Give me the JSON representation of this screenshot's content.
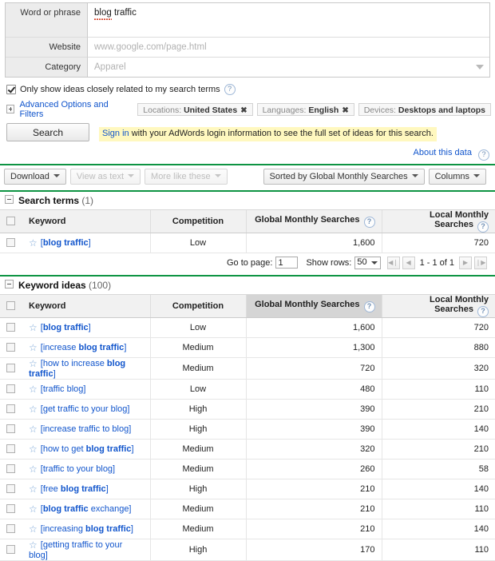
{
  "form": {
    "word_label": "Word or phrase",
    "word_value": "blog traffic",
    "word_misspelled": "blog",
    "word_rest": " traffic",
    "website_label": "Website",
    "website_placeholder": "www.google.com/page.html",
    "category_label": "Category",
    "category_placeholder": "Apparel"
  },
  "options": {
    "only_show_label": "Only show ideas closely related to my search terms",
    "advanced_label": "Advanced Options and Filters",
    "chips": [
      {
        "prefix": "Locations: ",
        "value": "United States",
        "closable": true,
        "x": "✖"
      },
      {
        "prefix": "Languages: ",
        "value": "English",
        "closable": true,
        "x": "✖"
      },
      {
        "prefix": "Devices: ",
        "value": "Desktops and laptops",
        "closable": false,
        "x": ""
      }
    ]
  },
  "search": {
    "button_label": "Search",
    "notice_link": "Sign in",
    "notice_text": " with your AdWords login information to see the full set of ideas for this search.",
    "about_link": "About this data"
  },
  "toolbar": {
    "download_label": "Download",
    "view_as_text_label": "View as text",
    "more_like_these_label": "More like these",
    "sorted_by_label": "Sorted by Global Monthly Searches",
    "columns_label": "Columns"
  },
  "search_terms_section": {
    "title": "Search terms",
    "count": "(1)",
    "headers": {
      "keyword": "Keyword",
      "competition": "Competition",
      "global": "Global Monthly Searches",
      "local": "Local Monthly Searches"
    },
    "rows": [
      {
        "keyword_pre": "[",
        "keyword_bold": "blog traffic",
        "keyword_post": "]",
        "competition": "Low",
        "global": "1,600",
        "local": "720"
      }
    ]
  },
  "pager": {
    "goto_label": "Go to page:",
    "goto_value": "1",
    "showrows_label": "Show rows:",
    "showrows_value": "50",
    "range": "1 - 1 of 1",
    "first": "◀❘",
    "prev": "◀",
    "next": "▶",
    "last": "❘▶"
  },
  "keyword_ideas_section": {
    "title": "Keyword ideas",
    "count": "(100)",
    "headers": {
      "keyword": "Keyword",
      "competition": "Competition",
      "global": "Global Monthly Searches",
      "local": "Local Monthly Searches"
    },
    "rows": [
      {
        "parts": [
          {
            "t": "[",
            "b": false
          },
          {
            "t": "blog traffic",
            "b": true
          },
          {
            "t": "]",
            "b": false
          }
        ],
        "competition": "Low",
        "global": "1,600",
        "local": "720"
      },
      {
        "parts": [
          {
            "t": "[increase ",
            "b": false
          },
          {
            "t": "blog traffic",
            "b": true
          },
          {
            "t": "]",
            "b": false
          }
        ],
        "competition": "Medium",
        "global": "1,300",
        "local": "880"
      },
      {
        "parts": [
          {
            "t": "[how to increase ",
            "b": false
          },
          {
            "t": "blog traffic",
            "b": true
          },
          {
            "t": "]",
            "b": false
          }
        ],
        "competition": "Medium",
        "global": "720",
        "local": "320"
      },
      {
        "parts": [
          {
            "t": "[traffic blog]",
            "b": false
          }
        ],
        "competition": "Low",
        "global": "480",
        "local": "110"
      },
      {
        "parts": [
          {
            "t": "[get traffic to your blog]",
            "b": false
          }
        ],
        "competition": "High",
        "global": "390",
        "local": "210"
      },
      {
        "parts": [
          {
            "t": "[increase traffic to blog]",
            "b": false
          }
        ],
        "competition": "High",
        "global": "390",
        "local": "140"
      },
      {
        "parts": [
          {
            "t": "[how to get ",
            "b": false
          },
          {
            "t": "blog traffic",
            "b": true
          },
          {
            "t": "]",
            "b": false
          }
        ],
        "competition": "Medium",
        "global": "320",
        "local": "210"
      },
      {
        "parts": [
          {
            "t": "[traffic to your blog]",
            "b": false
          }
        ],
        "competition": "Medium",
        "global": "260",
        "local": "58"
      },
      {
        "parts": [
          {
            "t": "[free ",
            "b": false
          },
          {
            "t": "blog traffic",
            "b": true
          },
          {
            "t": "]",
            "b": false
          }
        ],
        "competition": "High",
        "global": "210",
        "local": "140"
      },
      {
        "parts": [
          {
            "t": "[",
            "b": false
          },
          {
            "t": "blog traffic",
            "b": true
          },
          {
            "t": " exchange]",
            "b": false
          }
        ],
        "competition": "Medium",
        "global": "210",
        "local": "110"
      },
      {
        "parts": [
          {
            "t": "[increasing ",
            "b": false
          },
          {
            "t": "blog traffic",
            "b": true
          },
          {
            "t": "]",
            "b": false
          }
        ],
        "competition": "Medium",
        "global": "210",
        "local": "140"
      },
      {
        "parts": [
          {
            "t": "[getting traffic to your blog]",
            "b": false
          }
        ],
        "competition": "High",
        "global": "170",
        "local": "110"
      }
    ]
  },
  "icons": {
    "help": "?",
    "star": "☆",
    "collapse": "-"
  },
  "colors": {
    "green_bar": "#0e9443",
    "link": "#1155cc",
    "notice_bg": "#fff8bf",
    "sorted_header": "#d5d5d5"
  }
}
